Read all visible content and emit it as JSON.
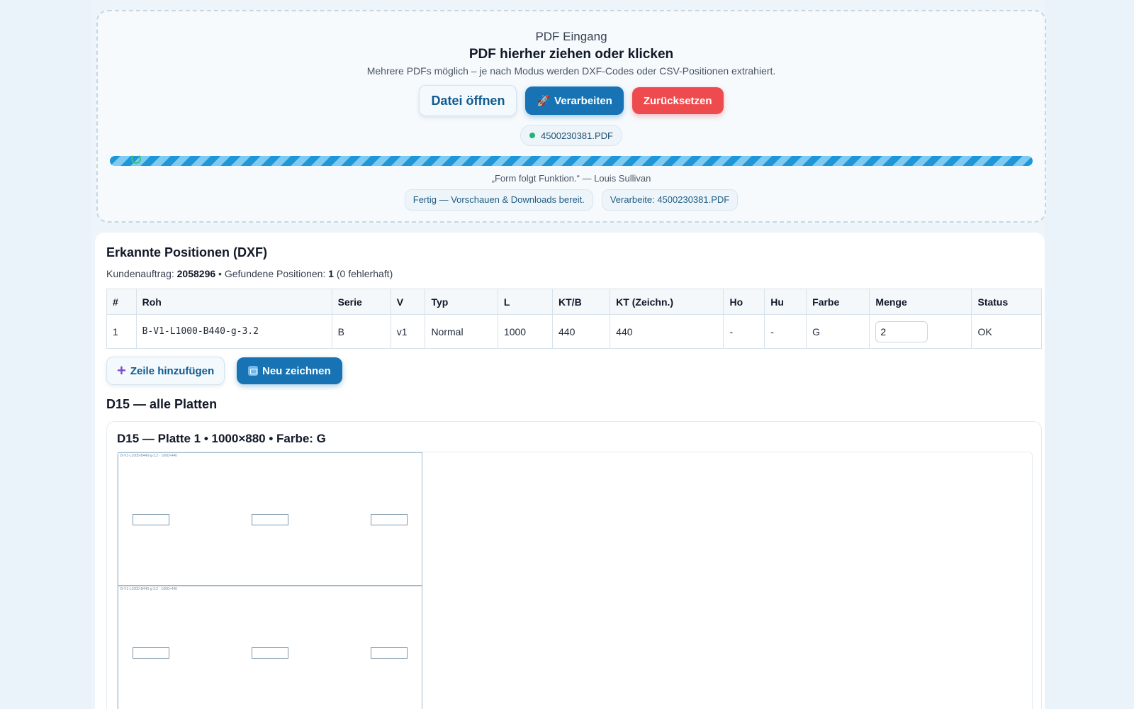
{
  "dropzone": {
    "label": "PDF Eingang",
    "title": "PDF hierher ziehen oder klicken",
    "subtitle": "Mehrere PDFs möglich – je nach Modus werden DXF-Codes oder CSV-Positionen extrahiert.",
    "open_label": "Datei öffnen",
    "process_label": "Verarbeiten",
    "process_icon": "rocket-icon",
    "reset_label": "Zurücksetzen",
    "file_name": "4500230381.PDF",
    "file_status_color": "#22b573",
    "progress": 1.0,
    "quote": "„Form folgt Funktion.“ — Louis Sullivan",
    "status_done": "Fertig — Vorschauen & Downloads bereit.",
    "status_processing": "Verarbeite: 4500230381.PDF"
  },
  "positions": {
    "title": "Erkannte Positionen (DXF)",
    "meta_prefix": "Kundenauftrag:",
    "order_number": "2058296",
    "meta_found": "• Gefundene Positionen:",
    "found_count": "1",
    "meta_errors": "(0 fehlerhaft)",
    "columns": [
      "#",
      "Roh",
      "Serie",
      "V",
      "Typ",
      "L",
      "KT/B",
      "KT (Zeichn.)",
      "Ho",
      "Hu",
      "Farbe",
      "Menge",
      "Status"
    ],
    "rows": [
      {
        "num": "1",
        "roh": "B-V1-L1000-B440-g-3.2",
        "serie": "B",
        "v": "v1",
        "typ": "Normal",
        "l": "1000",
        "ktb": "440",
        "kt_zeichn": "440",
        "ho": "-",
        "hu": "-",
        "farbe": "G",
        "menge": "2",
        "status": "OK"
      }
    ],
    "add_row_label": "Zeile hinzufügen",
    "redraw_label": "Neu zeichnen"
  },
  "d15": {
    "title": "D15 — alle Platten",
    "plate_title": "D15 — Platte 1 • 1000×880 • Farbe: G",
    "part_label": "B-V1-L1000-B440-g-3.2 · 1000×440"
  },
  "colors": {
    "accent": "#1773b3",
    "danger": "#ee4b4e",
    "background": "#eef5fa"
  }
}
